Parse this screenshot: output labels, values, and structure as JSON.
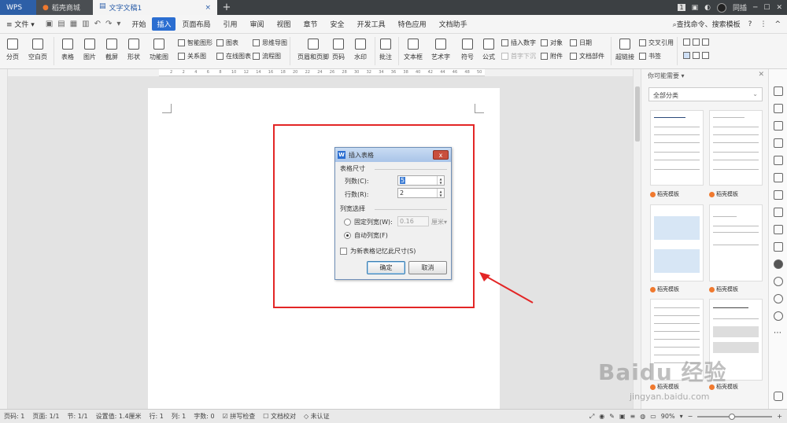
{
  "titlebar": {
    "wps_tab": "WPS",
    "store_tab": "稻壳商城",
    "doc_tab": "文字文稿1",
    "badge": "1",
    "user": "同插"
  },
  "menubar": {
    "file": "文件",
    "items": [
      "开始",
      "插入",
      "页面布局",
      "引用",
      "审阅",
      "视图",
      "章节",
      "安全",
      "开发工具",
      "特色应用",
      "文档助手"
    ],
    "active": "插入",
    "search": "查找命令、搜索模板"
  },
  "ribbon": {
    "pagebreak": "分页",
    "blankpage": "空白页",
    "table": "表格",
    "picture": "图片",
    "screenshot": "截屏",
    "shape": "形状",
    "funcmap": "功能图",
    "smartart": "智能图形",
    "chart": "图表",
    "mindmap": "思维导图",
    "relation": "关系图",
    "onlinechart": "在线图表",
    "flowchart": "流程图",
    "headerfooter": "页眉和页脚",
    "pagenum": "页码",
    "watermark": "水印",
    "comment": "批注",
    "textbox": "文本框",
    "arttext": "艺术字",
    "symbol": "符号",
    "formula": "公式",
    "insertnum": "插入数字",
    "object": "对象",
    "date": "日期",
    "dropcap": "首字下沉",
    "attachment": "附件",
    "docpart": "文档部件",
    "hyperlink": "超链接",
    "crossref": "交叉引用",
    "bookmark": "书签"
  },
  "ruler": {
    "nums": [
      "2",
      "2",
      "4",
      "6",
      "8",
      "10",
      "12",
      "14",
      "16",
      "18",
      "20",
      "22",
      "24",
      "26",
      "28",
      "30",
      "32",
      "34",
      "36",
      "38",
      "40",
      "42",
      "44",
      "46",
      "48",
      "50"
    ]
  },
  "dialog": {
    "title": "插入表格",
    "size_group": "表格尺寸",
    "cols_label": "列数(C):",
    "cols_value": "5",
    "rows_label": "行数(R):",
    "rows_value": "2",
    "width_group": "列宽选择",
    "fixed_label": "固定列宽(W):",
    "fixed_value": "0.16",
    "unit": "厘米",
    "auto_label": "自动列宽(F)",
    "remember_label": "为新表格记忆此尺寸(S)",
    "ok": "确定",
    "cancel": "取消",
    "close": "x"
  },
  "sidebar": {
    "header": "你可能需要",
    "filter": "全部分类",
    "cards": [
      "稻壳模板",
      "稻壳模板",
      "稻壳模板",
      "稻壳模板",
      "稻壳模板",
      "稻壳模板"
    ]
  },
  "status": {
    "page": "页码: 1",
    "pages": "页面: 1/1",
    "section": "节: 1/1",
    "setting": "设置值: 1.4厘米",
    "row": "行: 1",
    "col": "列: 1",
    "words": "字数: 0",
    "spell": "拼写检查",
    "proof": "文档校对",
    "cert": "未认证",
    "zoom": "90%"
  },
  "watermark": {
    "main": "Baidu 经验",
    "sub": "jingyan.baidu.com"
  },
  "colors": {
    "accent": "#2b6ed1",
    "highlight": "#e32626"
  }
}
